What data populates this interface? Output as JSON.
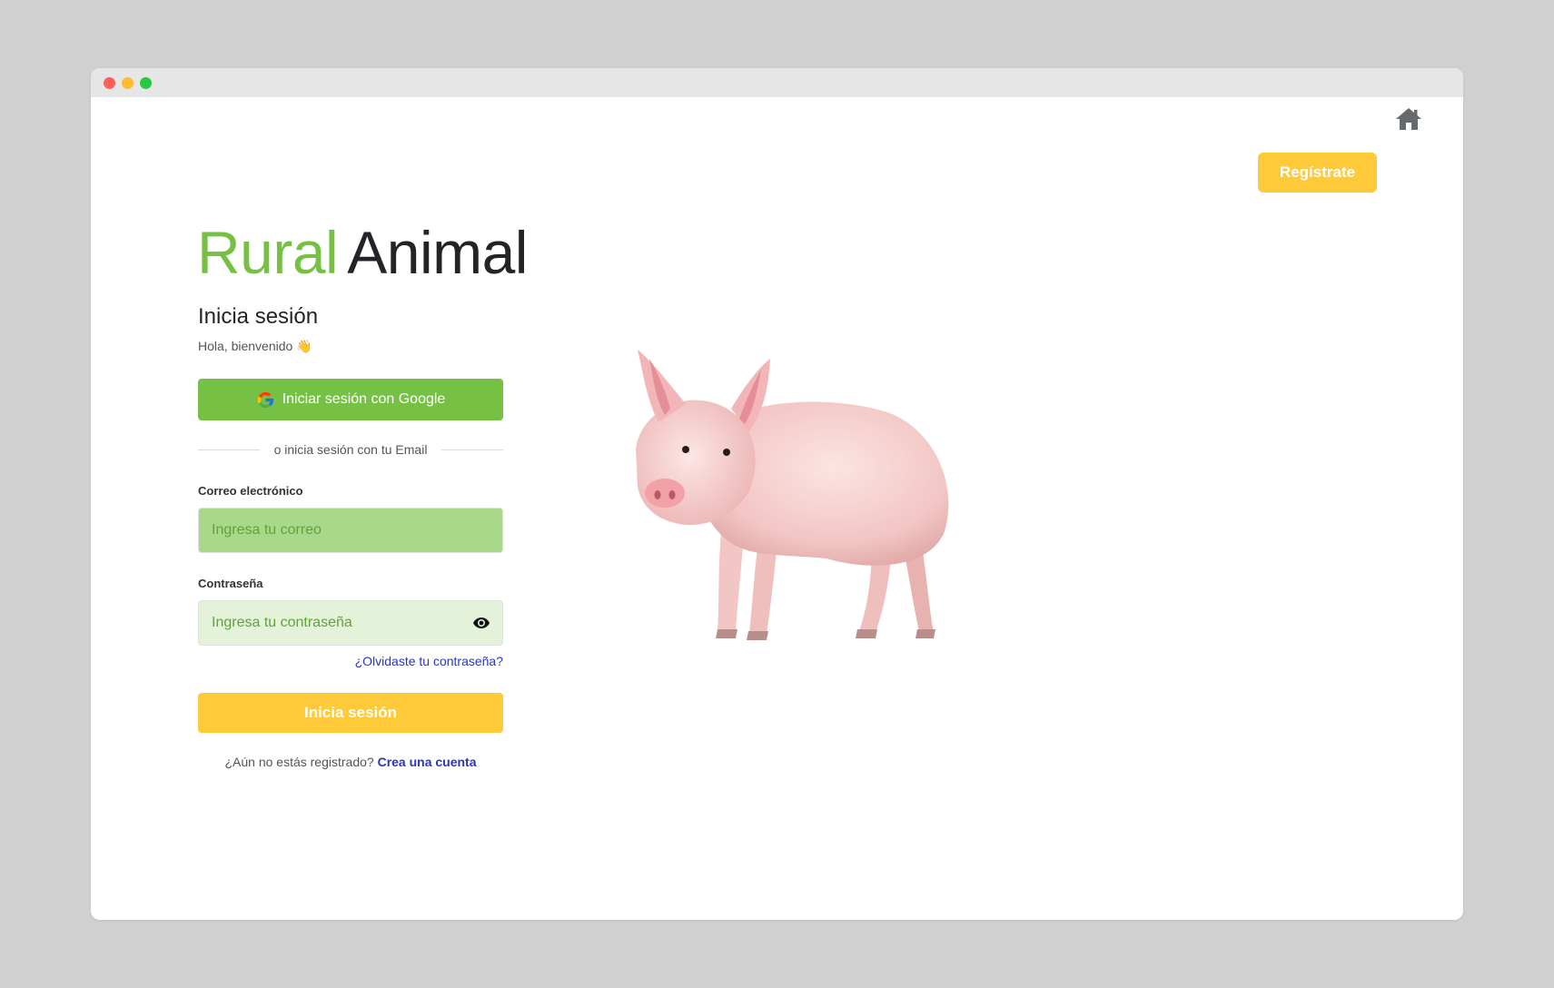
{
  "window": {
    "controls": [
      "close",
      "minimize",
      "maximize"
    ]
  },
  "header": {
    "home_icon": "home-icon",
    "register_label": "Regístrate"
  },
  "brand": {
    "part1": "Rural",
    "part2": "Animal",
    "colors": {
      "green": "#76c043",
      "dark": "#222428",
      "yellow": "#ffca3a",
      "link": "#2a35b8"
    }
  },
  "login": {
    "title": "Inicia sesión",
    "welcome": "Hola, bienvenido 👋",
    "google_label": "Iniciar sesión con Google",
    "google_icon": "google-icon",
    "divider_text": "o inicia sesión con tu Email",
    "email_label": "Correo electrónico",
    "email_placeholder": "Ingresa tu correo",
    "email_value": "",
    "password_label": "Contraseña",
    "password_placeholder": "Ingresa tu contraseña",
    "password_value": "",
    "eye_icon": "eye-icon",
    "forgot_label": "¿Olvidaste tu contraseña?",
    "submit_label": "Inicia sesión",
    "signup_prompt": "¿Aún no estás registrado?",
    "signup_link": "Crea una cuenta"
  },
  "illustration": {
    "subject": "pig"
  }
}
